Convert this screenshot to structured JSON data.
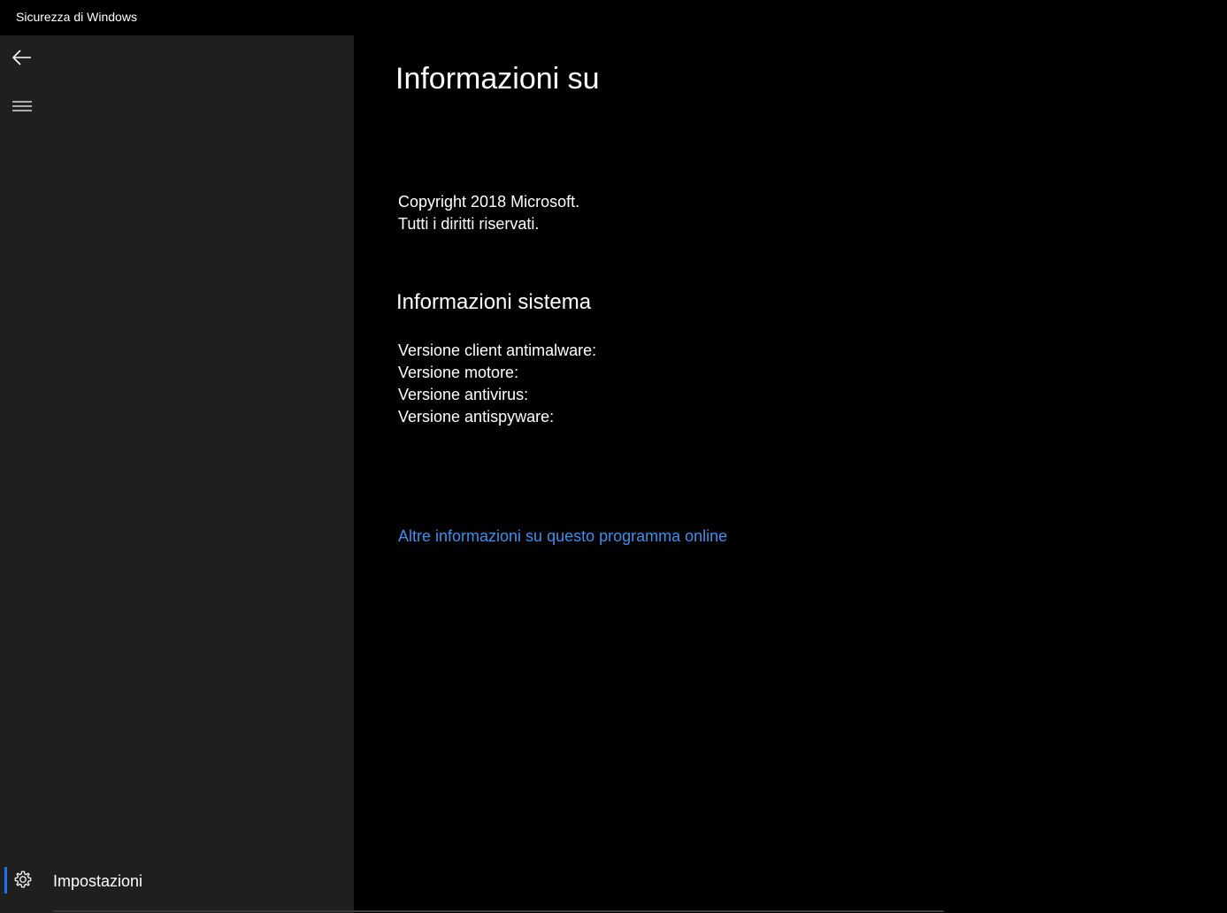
{
  "window": {
    "title": "Sicurezza di Windows"
  },
  "sidebar": {
    "back_icon": "back-arrow-icon",
    "menu_icon": "hamburger-menu-icon",
    "settings": {
      "icon": "gear-icon",
      "label": "Impostazioni"
    }
  },
  "main": {
    "title": "Informazioni su",
    "copyright": [
      "Copyright 2018 Microsoft.",
      "Tutti i diritti riservati."
    ],
    "system_info": {
      "title": "Informazioni sistema",
      "lines": [
        "Versione client antimalware:",
        "Versione motore:",
        "Versione antivirus:",
        "Versione antispyware:"
      ]
    },
    "more_info_link": "Altre informazioni su questo programma online"
  },
  "colors": {
    "background": "#000000",
    "sidebar": "#1f1f1f",
    "accent": "#1a73e8",
    "link": "#3f8fe8",
    "text": "#ffffff"
  }
}
